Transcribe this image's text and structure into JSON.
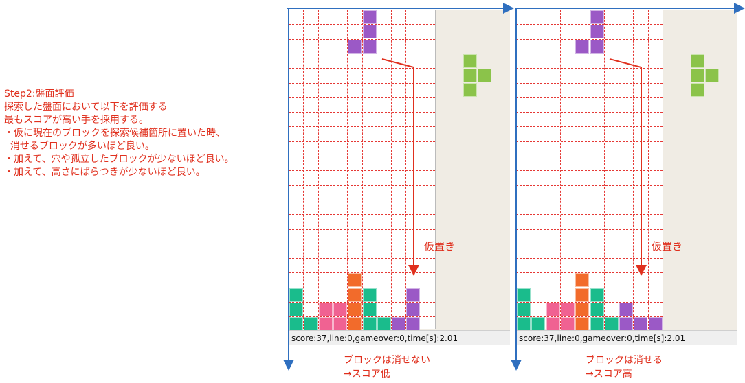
{
  "description": {
    "lines": [
      "Step2:盤面評価",
      "探索した盤面において以下を評価する",
      "最もスコアが高い手を採用する。",
      "・仮に現在のブロックを探索候補箇所に置いた時、",
      "  消せるブロックが多いほど良い。",
      "・加えて、穴や孤立したブロックが少ないほど良い。",
      "・加えて、高さにばらつきが少ないほど良い。"
    ]
  },
  "colors": {
    "purple": "#9b59c6",
    "green": "#8bc34a",
    "teal": "#1abc8c",
    "pink": "#f06292",
    "orange": "#f26b2b",
    "accent_red": "#e0301e",
    "axis_blue": "#2f6fbf"
  },
  "panels": [
    {
      "status": "score:37,line:0,gameover:0,time[s]:2.01",
      "place_label": "仮置き",
      "caption": "ブロックは消せない\n→スコア低",
      "blocks": [
        {
          "c": 5,
          "r": 0,
          "color": "purple"
        },
        {
          "c": 5,
          "r": 1,
          "color": "purple"
        },
        {
          "c": 5,
          "r": 2,
          "color": "purple"
        },
        {
          "c": 4,
          "r": 2,
          "color": "purple"
        },
        {
          "c": 0,
          "r": 19,
          "color": "teal"
        },
        {
          "c": 0,
          "r": 20,
          "color": "teal"
        },
        {
          "c": 0,
          "r": 21,
          "color": "teal"
        },
        {
          "c": 1,
          "r": 21,
          "color": "teal"
        },
        {
          "c": 2,
          "r": 20,
          "color": "pink"
        },
        {
          "c": 3,
          "r": 20,
          "color": "pink"
        },
        {
          "c": 2,
          "r": 21,
          "color": "pink"
        },
        {
          "c": 3,
          "r": 21,
          "color": "pink"
        },
        {
          "c": 4,
          "r": 18,
          "color": "orange"
        },
        {
          "c": 4,
          "r": 19,
          "color": "orange"
        },
        {
          "c": 4,
          "r": 20,
          "color": "orange"
        },
        {
          "c": 4,
          "r": 21,
          "color": "orange"
        },
        {
          "c": 5,
          "r": 19,
          "color": "teal"
        },
        {
          "c": 5,
          "r": 20,
          "color": "teal"
        },
        {
          "c": 5,
          "r": 21,
          "color": "teal"
        },
        {
          "c": 6,
          "r": 21,
          "color": "teal"
        },
        {
          "c": 7,
          "r": 21,
          "color": "purple"
        },
        {
          "c": 8,
          "r": 21,
          "color": "purple"
        },
        {
          "c": 8,
          "r": 20,
          "color": "purple"
        },
        {
          "c": 8,
          "r": 19,
          "color": "purple"
        }
      ]
    },
    {
      "status": "score:37,line:0,gameover:0,time[s]:2.01",
      "place_label": "仮置き",
      "caption": "ブロックは消せる\n→スコア高",
      "blocks": [
        {
          "c": 5,
          "r": 0,
          "color": "purple"
        },
        {
          "c": 5,
          "r": 1,
          "color": "purple"
        },
        {
          "c": 5,
          "r": 2,
          "color": "purple"
        },
        {
          "c": 4,
          "r": 2,
          "color": "purple"
        },
        {
          "c": 0,
          "r": 19,
          "color": "teal"
        },
        {
          "c": 0,
          "r": 20,
          "color": "teal"
        },
        {
          "c": 0,
          "r": 21,
          "color": "teal"
        },
        {
          "c": 1,
          "r": 21,
          "color": "teal"
        },
        {
          "c": 2,
          "r": 20,
          "color": "pink"
        },
        {
          "c": 3,
          "r": 20,
          "color": "pink"
        },
        {
          "c": 2,
          "r": 21,
          "color": "pink"
        },
        {
          "c": 3,
          "r": 21,
          "color": "pink"
        },
        {
          "c": 4,
          "r": 18,
          "color": "orange"
        },
        {
          "c": 4,
          "r": 19,
          "color": "orange"
        },
        {
          "c": 4,
          "r": 20,
          "color": "orange"
        },
        {
          "c": 4,
          "r": 21,
          "color": "orange"
        },
        {
          "c": 5,
          "r": 19,
          "color": "teal"
        },
        {
          "c": 5,
          "r": 20,
          "color": "teal"
        },
        {
          "c": 5,
          "r": 21,
          "color": "teal"
        },
        {
          "c": 6,
          "r": 21,
          "color": "teal"
        },
        {
          "c": 7,
          "r": 20,
          "color": "purple"
        },
        {
          "c": 7,
          "r": 21,
          "color": "purple"
        },
        {
          "c": 8,
          "r": 21,
          "color": "purple"
        },
        {
          "c": 9,
          "r": 21,
          "color": "purple"
        }
      ]
    }
  ],
  "next_piece": {
    "color": "green",
    "shape": "T"
  }
}
